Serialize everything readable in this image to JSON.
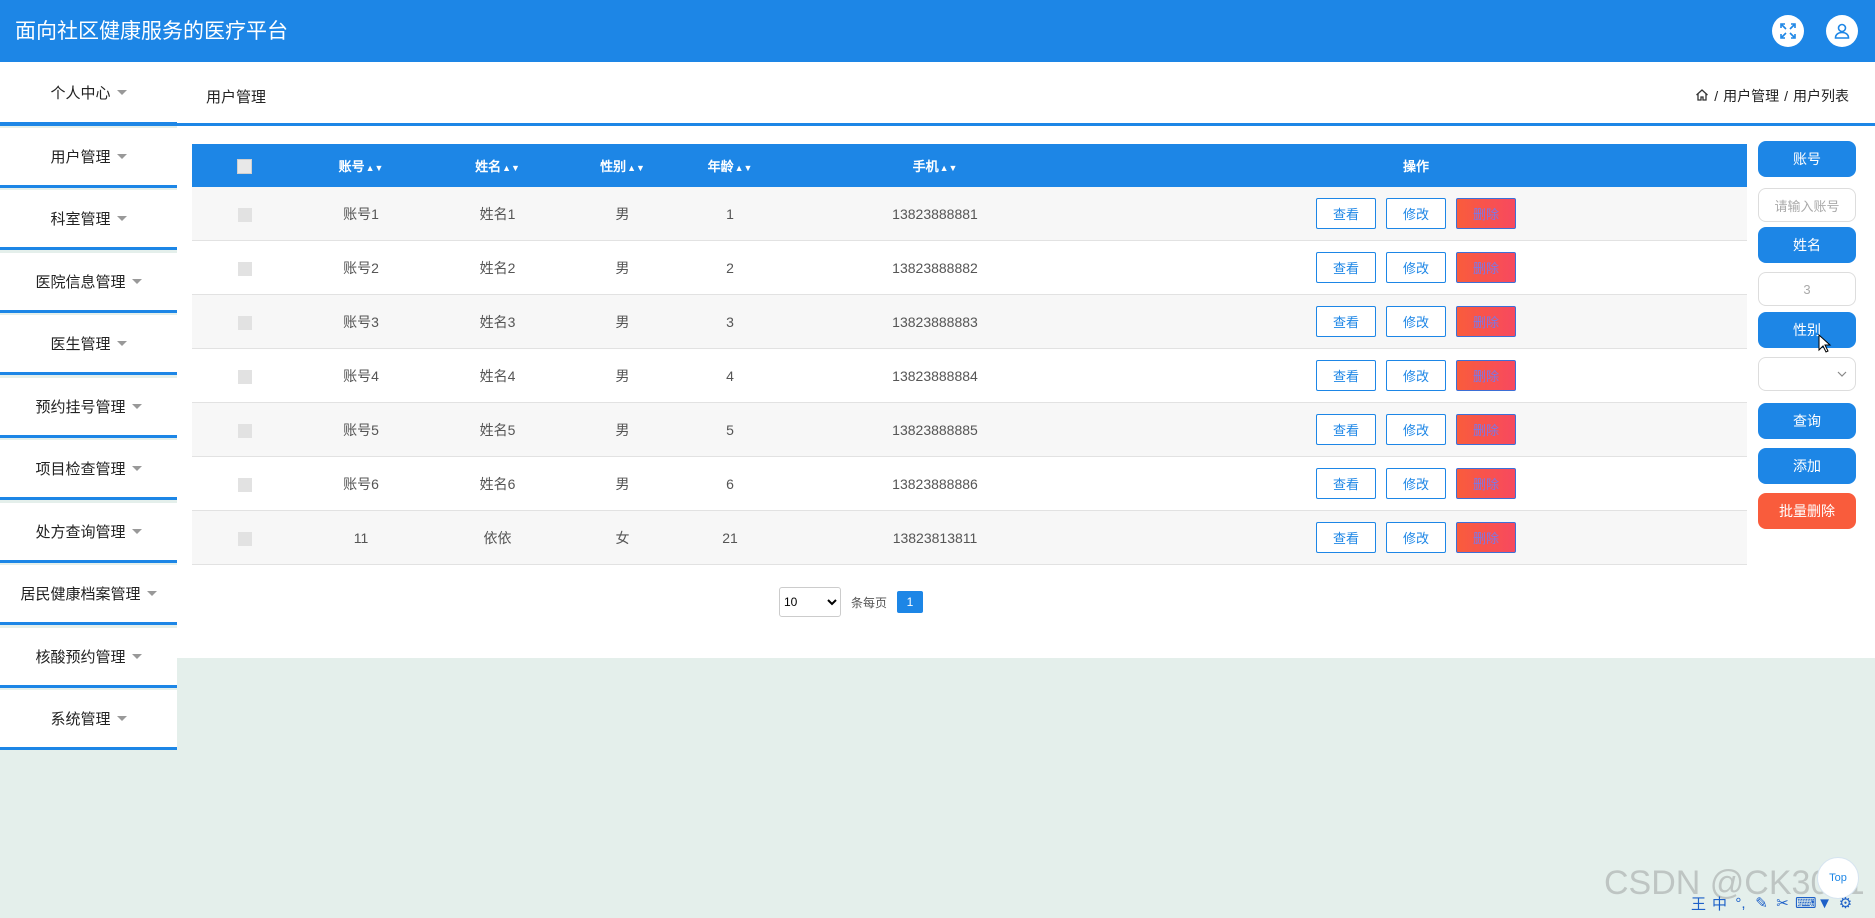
{
  "app": {
    "title": "面向社区健康服务的医疗平台"
  },
  "header": {
    "page_title": "用户管理"
  },
  "breadcrumb": [
    "用户管理",
    "用户列表"
  ],
  "sidebar": {
    "items": [
      {
        "label": "个人中心"
      },
      {
        "label": "用户管理"
      },
      {
        "label": "科室管理"
      },
      {
        "label": "医院信息管理"
      },
      {
        "label": "医生管理"
      },
      {
        "label": "预约挂号管理"
      },
      {
        "label": "项目检查管理"
      },
      {
        "label": "处方查询管理"
      },
      {
        "label": "居民健康档案管理"
      },
      {
        "label": "核酸预约管理"
      },
      {
        "label": "系统管理"
      }
    ]
  },
  "table": {
    "headers": [
      "账号",
      "姓名",
      "性别",
      "年龄",
      "手机",
      "操作"
    ],
    "rows": [
      {
        "account": "账号1",
        "name": "姓名1",
        "gender": "男",
        "age": "1",
        "phone": "13823888881"
      },
      {
        "account": "账号2",
        "name": "姓名2",
        "gender": "男",
        "age": "2",
        "phone": "13823888882"
      },
      {
        "account": "账号3",
        "name": "姓名3",
        "gender": "男",
        "age": "3",
        "phone": "13823888883"
      },
      {
        "account": "账号4",
        "name": "姓名4",
        "gender": "男",
        "age": "4",
        "phone": "13823888884"
      },
      {
        "account": "账号5",
        "name": "姓名5",
        "gender": "男",
        "age": "5",
        "phone": "13823888885"
      },
      {
        "account": "账号6",
        "name": "姓名6",
        "gender": "男",
        "age": "6",
        "phone": "13823888886"
      },
      {
        "account": "11",
        "name": "依依",
        "gender": "女",
        "age": "21",
        "phone": "13823813811"
      }
    ],
    "actions": {
      "view": "查看",
      "edit": "修改",
      "delete": "删除"
    }
  },
  "pagination": {
    "page_size": "10",
    "per_page_label": "条每页",
    "current_page": "1"
  },
  "search_panel": {
    "account_label": "账号",
    "account_placeholder": "请输入账号",
    "name_label": "姓名",
    "name_value": "3",
    "gender_label": "性别",
    "query_button": "查询",
    "add_button": "添加",
    "batch_delete_button": "批量删除"
  },
  "overlay": {
    "watermark": "CSDN @CK3011",
    "float_button": "Top"
  },
  "colors": {
    "primary": "#1d86e6",
    "danger": "#f95c3c",
    "background": "#e4efeb"
  }
}
